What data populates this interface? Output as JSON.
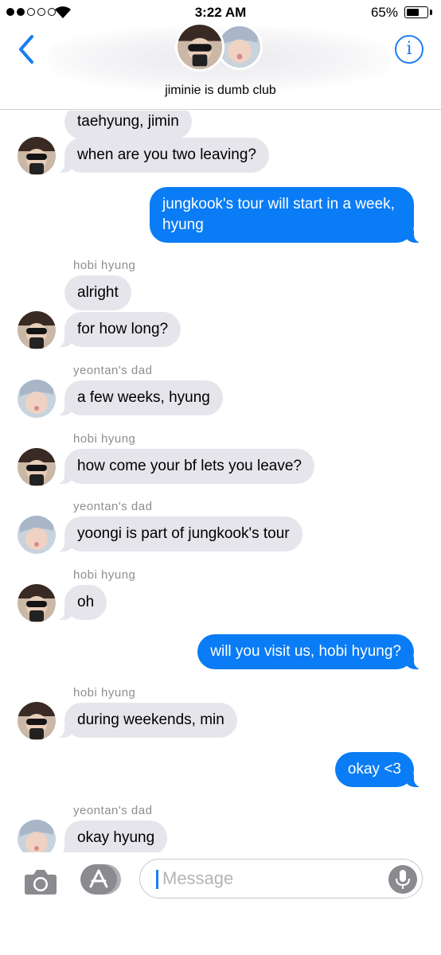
{
  "status_bar": {
    "time": "3:22 AM",
    "battery_percent_text": "65%",
    "battery_level": 0.65,
    "signal_bars_filled": 2,
    "signal_bars_total": 5
  },
  "header": {
    "group_name": "jiminie is dumb club",
    "info_label": "i"
  },
  "messages": [
    {
      "type": "in",
      "text": "taehyung, jimin"
    },
    {
      "type": "in",
      "text": "when are you two leaving?",
      "avatar": "hobi"
    },
    {
      "type": "out",
      "text": "jungkook's tour will start in a week, hyung"
    },
    {
      "type": "sender",
      "text": "hobi hyung"
    },
    {
      "type": "in",
      "text": "alright"
    },
    {
      "type": "in",
      "text": "for how long?",
      "avatar": "hobi"
    },
    {
      "type": "sender",
      "text": "yeontan's dad"
    },
    {
      "type": "in",
      "text": "a few weeks, hyung",
      "avatar": "yeontan"
    },
    {
      "type": "sender",
      "text": "hobi hyung"
    },
    {
      "type": "in",
      "text": "how come your bf lets you leave?",
      "avatar": "hobi"
    },
    {
      "type": "sender",
      "text": "yeontan's dad"
    },
    {
      "type": "in",
      "text": "yoongi is part of jungkook's tour",
      "avatar": "yeontan"
    },
    {
      "type": "sender",
      "text": "hobi hyung"
    },
    {
      "type": "in",
      "text": "oh",
      "avatar": "hobi"
    },
    {
      "type": "out",
      "text": "will you visit us, hobi hyung?"
    },
    {
      "type": "sender",
      "text": "hobi hyung"
    },
    {
      "type": "in",
      "text": "during weekends, min",
      "avatar": "hobi"
    },
    {
      "type": "out",
      "text": "okay <3"
    },
    {
      "type": "sender",
      "text": "yeontan's dad"
    },
    {
      "type": "in",
      "text": "okay hyung",
      "avatar": "yeontan"
    }
  ],
  "input": {
    "placeholder": "Message"
  },
  "colors": {
    "accent": "#0a7cf5",
    "incoming_bubble": "#e6e5eb",
    "sender_label": "#8e8e93"
  },
  "icons": [
    "back-chevron-icon",
    "info-icon",
    "camera-icon",
    "app-store-icon",
    "microphone-icon",
    "wifi-icon",
    "battery-icon"
  ]
}
